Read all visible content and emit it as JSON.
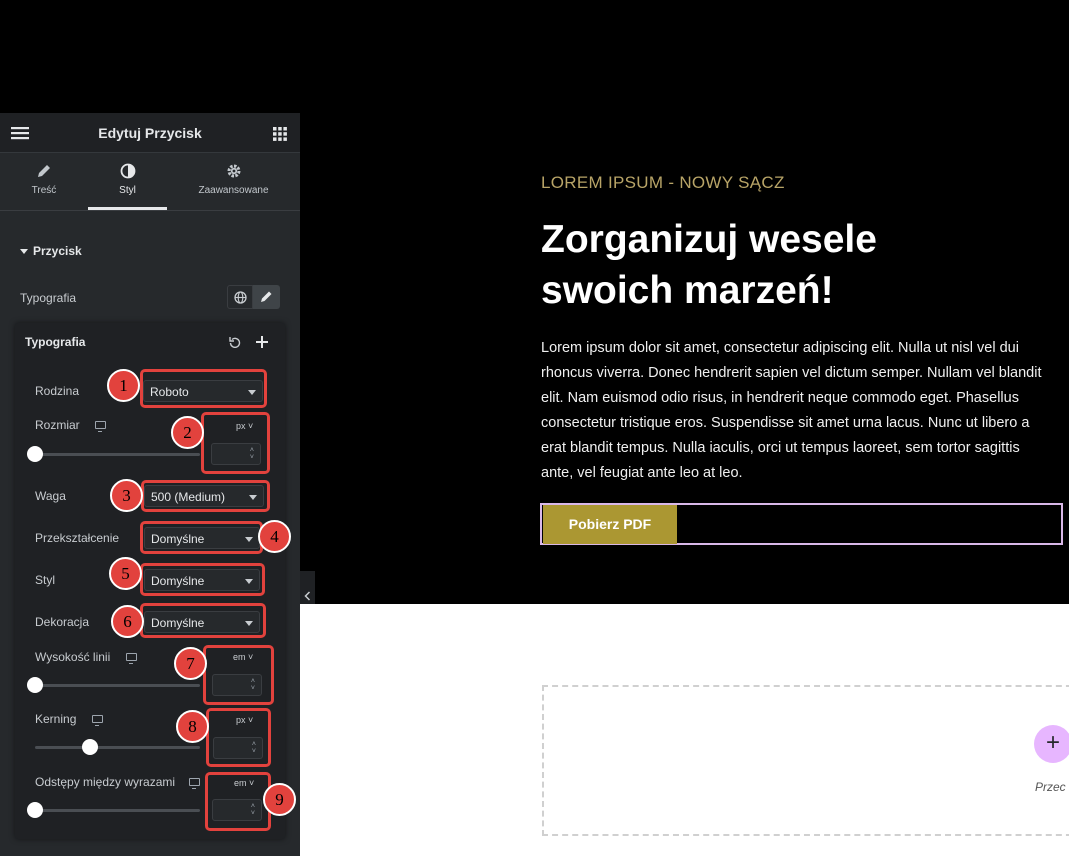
{
  "panel": {
    "title": "Edytuj Przycisk",
    "tabs": [
      {
        "label": "Treść",
        "icon": "pencil-icon"
      },
      {
        "label": "Styl",
        "icon": "contrast-icon"
      },
      {
        "label": "Zaawansowane",
        "icon": "gear-icon"
      }
    ],
    "section_title": "Przycisk",
    "typography_label": "Typografia"
  },
  "popover": {
    "title": "Typografia",
    "fields": {
      "family": {
        "label": "Rodzina",
        "value": "Roboto"
      },
      "size": {
        "label": "Rozmiar",
        "unit": "px"
      },
      "weight": {
        "label": "Waga",
        "value": "500 (Medium)"
      },
      "transform": {
        "label": "Przekształcenie",
        "value": "Domyślne"
      },
      "style": {
        "label": "Styl",
        "value": "Domyślne"
      },
      "decoration": {
        "label": "Dekoracja",
        "value": "Domyślne"
      },
      "line_height": {
        "label": "Wysokość linii",
        "unit": "em"
      },
      "kerning": {
        "label": "Kerning",
        "unit": "px"
      },
      "word_spacing": {
        "label": "Odstępy między wyrazami",
        "unit": "em"
      }
    }
  },
  "badges": [
    "1",
    "2",
    "3",
    "4",
    "5",
    "6",
    "7",
    "8",
    "9"
  ],
  "hero": {
    "eyebrow": "LOREM IPSUM - NOWY SĄCZ",
    "heading_line1": "Zorganizuj wesele",
    "heading_line2": "swoich marzeń!",
    "body": "Lorem ipsum dolor sit amet, consectetur adipiscing elit. Nulla ut nisl vel dui rhoncus viverra. Donec hendrerit sapien vel dictum semper. Nullam vel blandit elit. Nam euismod odio risus, in hendrerit neque commodo eget. Phasellus consectetur tristique eros. Suspendisse sit amet urna lacus. Nunc ut libero a erat blandit tempus. Nulla iaculis, orci ut tempus laoreet, sem tortor sagittis ante, vel feugiat ante leo at leo.",
    "button_label": "Pobierz PDF"
  },
  "dropzone": {
    "label": "Przec"
  },
  "colors": {
    "accent": "#ab9732",
    "highlight": "#e2423d",
    "eyebrow": "#b8a467"
  }
}
